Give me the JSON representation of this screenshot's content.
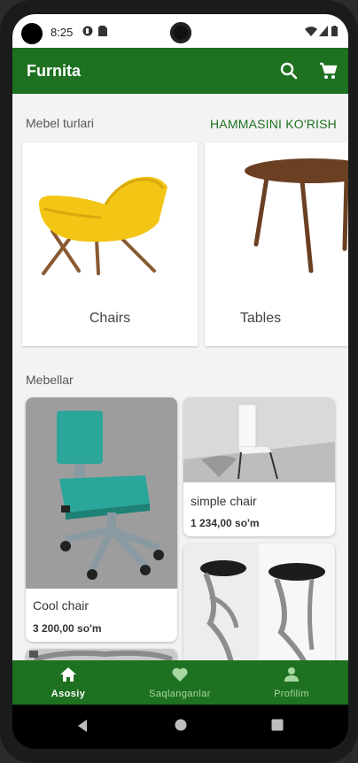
{
  "status": {
    "time": "8:25"
  },
  "appbar": {
    "title": "Furnita"
  },
  "categories_section": {
    "title": "Mebel turlari",
    "see_all": "HAMMASINI KO'RISH",
    "items": [
      {
        "label": "Chairs"
      },
      {
        "label": "Tables"
      }
    ]
  },
  "products_section": {
    "title": "Mebellar",
    "items": [
      {
        "name": "Cool chair",
        "price": "3 200,00 so'm"
      },
      {
        "name": "simple chair",
        "price": "1 234,00 so'm"
      }
    ]
  },
  "bottom_nav": {
    "items": [
      {
        "label": "Asosiy",
        "icon": "home-icon",
        "active": true
      },
      {
        "label": "Saqlanganlar",
        "icon": "heart-icon",
        "active": false
      },
      {
        "label": "Profilim",
        "icon": "person-icon",
        "active": false
      }
    ]
  },
  "colors": {
    "primary": "#1e7120",
    "background": "#f3f3f3"
  }
}
